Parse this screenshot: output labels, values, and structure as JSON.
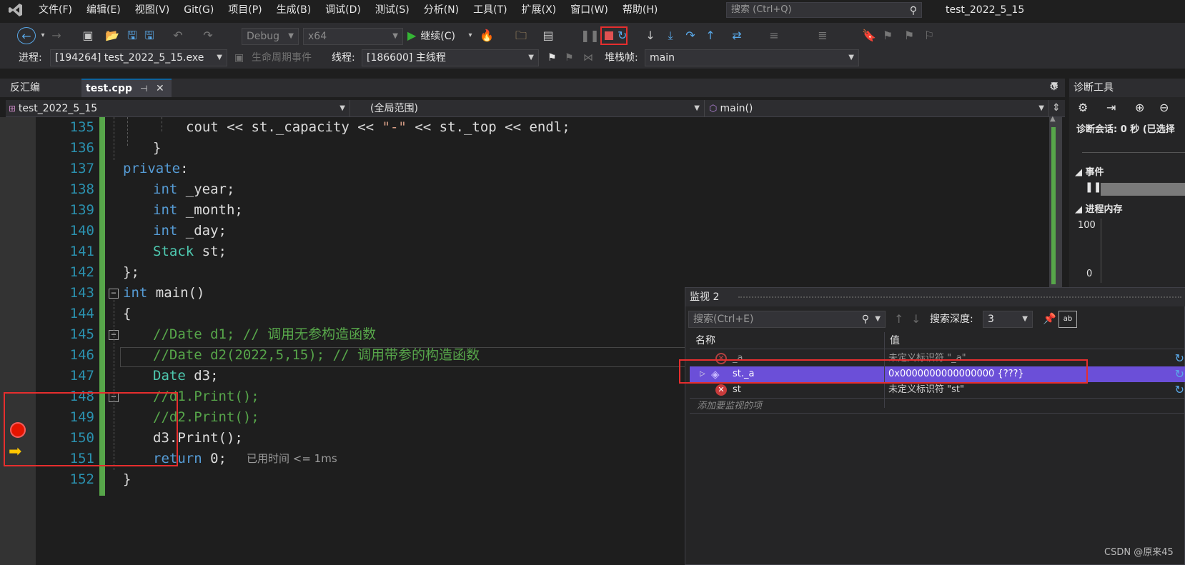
{
  "menubar": {
    "items": [
      "文件(F)",
      "编辑(E)",
      "视图(V)",
      "Git(G)",
      "项目(P)",
      "生成(B)",
      "调试(D)",
      "测试(S)",
      "分析(N)",
      "工具(T)",
      "扩展(X)",
      "窗口(W)",
      "帮助(H)"
    ],
    "search_placeholder": "搜索 (Ctrl+Q)",
    "solution_name": "test_2022_5_15"
  },
  "toolbar": {
    "config": "Debug",
    "platform": "x64",
    "continue_label": "继续(C)"
  },
  "debug_location": {
    "process_label": "进程:",
    "process_value": "[194264] test_2022_5_15.exe",
    "lifecycle_label": "生命周期事件",
    "thread_label": "线程:",
    "thread_value": "[186600] 主线程",
    "stackframe_label": "堆栈帧:",
    "stackframe_value": "main"
  },
  "doc_tabs": {
    "tab1": "反汇编",
    "tab2": "test.cpp"
  },
  "navbar": {
    "project": "test_2022_5_15",
    "scope": "(全局范围)",
    "member": "main()"
  },
  "editor": {
    "line_numbers": [
      "135",
      "136",
      "137",
      "138",
      "139",
      "140",
      "141",
      "142",
      "143",
      "144",
      "145",
      "146",
      "147",
      "148",
      "149",
      "150",
      "151",
      "152"
    ],
    "lines": {
      "l135_a": "cout << st._capacity << ",
      "l135_b": "\"-\"",
      "l135_c": " << st._top << endl;",
      "l136": "}",
      "l137_kw": "private",
      "l137_rest": ":",
      "l138_kw": "int",
      "l138_rest": " _year;",
      "l139_kw": "int",
      "l139_rest": " _month;",
      "l140_kw": "int",
      "l140_rest": " _day;",
      "l141_ty": "Stack",
      "l141_rest": " st;",
      "l142": "};",
      "l143_kw": "int",
      "l143_rest": " main()",
      "l144": "{",
      "l145": "//Date d1; // 调用无参构造函数",
      "l146": "//Date d2(2022,5,15); // 调用带参的构造函数",
      "l147_ty": "Date",
      "l147_rest": " d3;",
      "l148": "//d1.Print();",
      "l149": "//d2.Print();",
      "l150": "d3.Print();",
      "l151_kw": "return",
      "l151_rest": " 0;",
      "l152": "}"
    },
    "elapsed_label": "已用时间 <= 1ms"
  },
  "diagnostics": {
    "title": "诊断工具",
    "session": "诊断会话: 0 秒 (已选择",
    "events_label": "事件",
    "memory_label": "进程内存",
    "y_max": "100",
    "y_min": "0"
  },
  "watch": {
    "title": "监视 2",
    "search_placeholder": "搜索(Ctrl+E)",
    "depth_label": "搜索深度:",
    "depth_value": "3",
    "col_name": "名称",
    "col_value": "值",
    "rows": [
      {
        "name": "_a",
        "value": "未定义标识符 \"_a\""
      },
      {
        "name": "st._a",
        "value": "0x0000000000000000 {???}"
      },
      {
        "name": "st",
        "value": "未定义标识符 \"st\""
      }
    ],
    "add_item": "添加要监视的项"
  },
  "watermark": "CSDN @原来45",
  "colors": {
    "breakpoint": "#e51400",
    "exec_arrow": "#ffc600",
    "selected_row": "#6b4fd8",
    "highlight_box": "#e62e2e",
    "change_bar": "#57a64a"
  }
}
